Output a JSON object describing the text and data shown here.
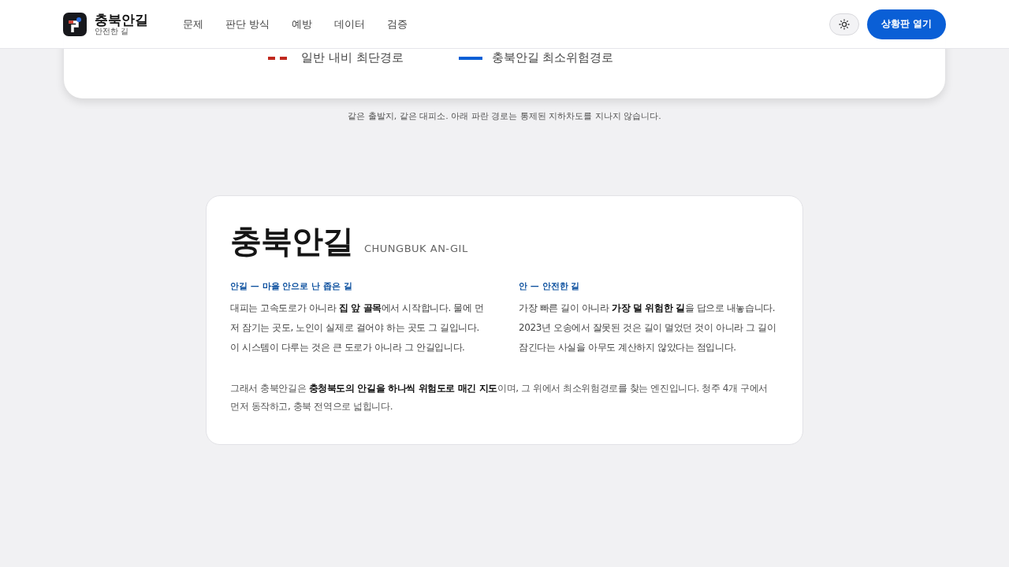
{
  "header": {
    "brand": "충북안길",
    "tagline": "안전한 길",
    "nav": [
      {
        "label": "문제"
      },
      {
        "label": "판단 방식"
      },
      {
        "label": "예방"
      },
      {
        "label": "데이터"
      },
      {
        "label": "검증"
      }
    ],
    "cta": "상황판 열기"
  },
  "map_legend": [
    {
      "kind": "dashed",
      "color": "#c0281e",
      "label": "일반 내비 최단경로"
    },
    {
      "kind": "solid",
      "color": "#0a5fd6",
      "label": "충북안길 최소위험경로"
    }
  ],
  "caption": "같은 출발지, 같은 대피소. 아래 파란 경로는 통제된 지하차도를 지나지 않습니다.",
  "about": {
    "title": "충북안길",
    "subtitle": "CHUNGBUK AN-GIL",
    "columns": [
      {
        "heading": "안길 — 마을 안으로 난 좁은 길",
        "text": "대피는 고속도로가 아니라 **집 앞 골목**에서 시작합니다. 물에 먼저 잠기는 곳도, 노인이 실제로 걸어야 하는 곳도 그 길입니다. 이 시스템이 다루는 것은 큰 도로가 아니라 그 안길입니다."
      },
      {
        "heading": "안 — 안전한 길",
        "text": "가장 빠른 길이 아니라 **가장 덜 위험한 길**을 답으로 내놓습니다. 2023년 오송에서 잘못된 것은 길이 멀었던 것이 아니라 그 길이 잠긴다는 사실을 아무도 계산하지 않았다는 점입니다."
      }
    ],
    "summary": "그래서 충북안길은 **충청북도의 안길을 하나씩 위험도로 매긴 지도**이며, 그 위에서 최소위험경로를 찾는 엔진입니다. 청주 4개 구에서 먼저 동작하고, 충북 전역으로 넓힙니다."
  }
}
